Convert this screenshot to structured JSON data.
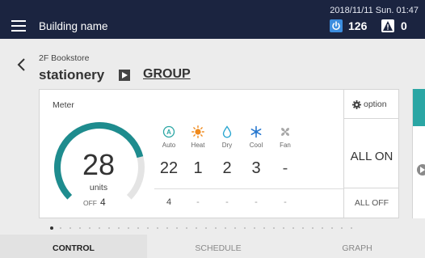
{
  "header": {
    "building_name": "Building name",
    "datetime": "2018/11/11 Sun. 01:47",
    "power_count": "126",
    "alert_count": "0",
    "colors": {
      "bar": "#1b2440",
      "power": "#3c8dde"
    }
  },
  "breadcrumb": {
    "floor": "2F Bookstore",
    "name": "stationery",
    "group_link": "GROUP"
  },
  "meter": {
    "label": "Meter",
    "units_value": "28",
    "units_label": "units",
    "off_label": "OFF",
    "off_count": "4",
    "gauge_level": 0.78,
    "gauge_color": "#1e8c8e",
    "modes": [
      {
        "name": "Auto",
        "icon": "auto-icon",
        "count": "22",
        "off": "4",
        "color": "#2aa6a4"
      },
      {
        "name": "Heat",
        "icon": "sun-icon",
        "count": "1",
        "off": "-",
        "color": "#f08a1c"
      },
      {
        "name": "Dry",
        "icon": "droplet-icon",
        "count": "2",
        "off": "-",
        "color": "#2aa6d0"
      },
      {
        "name": "Cool",
        "icon": "snowflake-icon",
        "count": "3",
        "off": "-",
        "color": "#2a7ad0"
      },
      {
        "name": "Fan",
        "icon": "fan-icon",
        "count": "-",
        "off": "-",
        "color": "#a0a0a0"
      }
    ]
  },
  "controls": {
    "option_label": "option",
    "all_on_label": "ALL ON",
    "all_off_label": "ALL OFF"
  },
  "pager": {
    "total": 32,
    "active": 0
  },
  "tabs": [
    {
      "label": "CONTROL",
      "active": true
    },
    {
      "label": "SCHEDULE",
      "active": false
    },
    {
      "label": "GRAPH",
      "active": false
    }
  ]
}
